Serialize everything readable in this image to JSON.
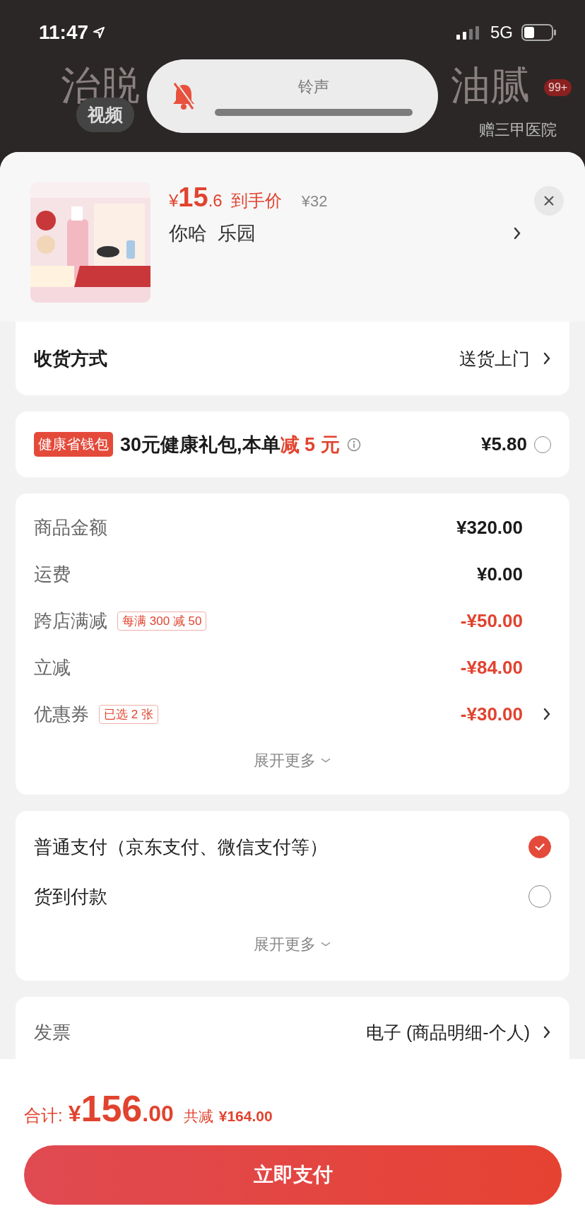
{
  "status_bar": {
    "time": "11:47",
    "network": "5G"
  },
  "background": {
    "headline_left": "治脱",
    "headline_right": "油腻",
    "tab": "视频",
    "badge": "99+",
    "tag": "赠三甲医院"
  },
  "ringer": {
    "label": "铃声",
    "muted": true
  },
  "product": {
    "currency": "¥",
    "price_int": "15",
    "price_dec": ".6",
    "price_label": "到手价",
    "original_price": "¥32",
    "name": "你哈  乐园"
  },
  "delivery": {
    "label": "收货方式",
    "value": "送货上门"
  },
  "wallet": {
    "badge": "健康省钱包",
    "text": "30元健康礼包,本单",
    "highlight": "减 5 元",
    "price": "¥5.80",
    "selected": false
  },
  "amounts": {
    "rows": [
      {
        "label": "商品金额",
        "value": "¥320.00",
        "kind": "normal",
        "link": false
      },
      {
        "label": "运费",
        "value": "¥0.00",
        "kind": "normal",
        "link": false
      },
      {
        "label": "跨店满减",
        "tag": "每满 300 减 50",
        "value": "-¥50.00",
        "kind": "discount",
        "link": false
      },
      {
        "label": "立减",
        "value": "-¥84.00",
        "kind": "discount",
        "link": false
      },
      {
        "label": "优惠券",
        "tag": "已选 2 张",
        "value": "-¥30.00",
        "kind": "discount",
        "link": true
      }
    ],
    "more": "展开更多"
  },
  "payment": {
    "options": [
      {
        "label": "普通支付（京东支付、微信支付等）",
        "selected": true
      },
      {
        "label": "货到付款",
        "selected": false
      }
    ],
    "more": "展开更多"
  },
  "invoice": {
    "label": "发票",
    "value": "电子 (商品明细-个人)"
  },
  "footer": {
    "total_label": "合计:",
    "currency": "¥",
    "total_int": "156",
    "total_dec": ".00",
    "saved_label": "共减",
    "saved": "¥164.00",
    "pay_button": "立即支付"
  }
}
